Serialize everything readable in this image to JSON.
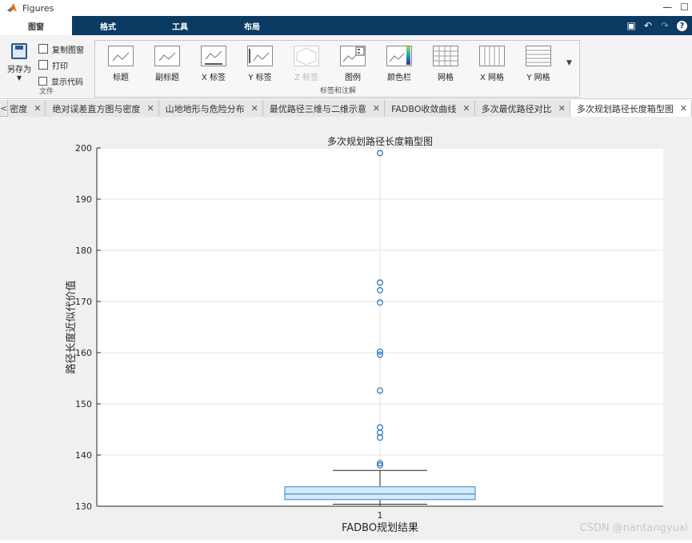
{
  "window": {
    "title": "Figures"
  },
  "ribbon": {
    "tabs": [
      {
        "label": "图窗",
        "active": true
      },
      {
        "label": "格式",
        "active": false
      },
      {
        "label": "工具",
        "active": false
      },
      {
        "label": "布局",
        "active": false
      }
    ],
    "file_section": {
      "label": "文件",
      "save_as": "另存为",
      "copy_figure": "复制图窗",
      "print": "打印",
      "show_code": "显示代码"
    },
    "labels_section": {
      "label": "标签和注解",
      "buttons": [
        "标题",
        "副标题",
        "X 标签",
        "Y 标签",
        "Z 标签",
        "图例",
        "颜色栏",
        "网格",
        "X 网格",
        "Y 网格"
      ]
    }
  },
  "doc_tabs": [
    {
      "label": "密度",
      "active": false
    },
    {
      "label": "绝对误差直方图与密度",
      "active": false
    },
    {
      "label": "山地地形与危险分布",
      "active": false
    },
    {
      "label": "最优路径三维与二维示意",
      "active": false
    },
    {
      "label": "FADBO收敛曲线",
      "active": false
    },
    {
      "label": "多次最优路径对比",
      "active": false
    },
    {
      "label": "多次规划路径长度箱型图",
      "active": true
    }
  ],
  "watermark": "CSDN @nantangyuxi",
  "colors": {
    "ribbon_bar": "#0b3a63",
    "box_fill": "#d6e9fb",
    "box_edge": "#4f9bd8",
    "outlier": "#1f72b8"
  },
  "chart_data": {
    "type": "box",
    "title": "多次规划路径长度箱型图",
    "xlabel": "FADBO规划结果",
    "ylabel": "路径长度近似代价值",
    "categories": [
      "1"
    ],
    "ylim": [
      130,
      200
    ],
    "yticks": [
      130,
      140,
      150,
      160,
      170,
      180,
      190,
      200
    ],
    "grid": true,
    "box": {
      "whisker_low": 130.4,
      "q1": 131.3,
      "median": 132.4,
      "q3": 133.8,
      "whisker_high": 137.0
    },
    "outliers": [
      138.0,
      138.4,
      143.4,
      144.4,
      145.4,
      152.6,
      159.6,
      160.2,
      169.8,
      172.2,
      173.7,
      199.0
    ]
  }
}
